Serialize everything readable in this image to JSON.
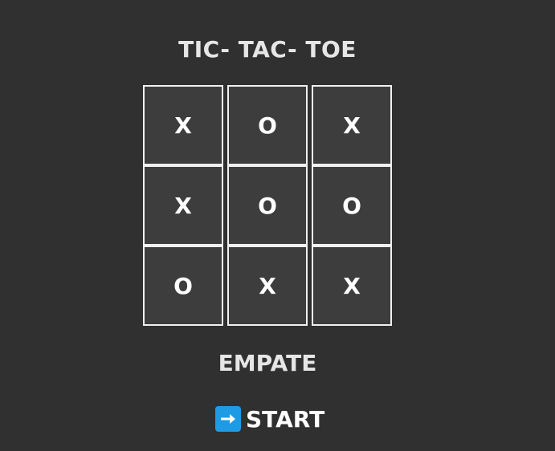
{
  "title": "TIC- TAC- TOE",
  "board": {
    "cells": [
      "X",
      "O",
      "X",
      "X",
      "O",
      "O",
      "O",
      "X",
      "X"
    ]
  },
  "status": "EMPATE",
  "start_button": {
    "label": "START",
    "icon": "right-arrow-icon",
    "icon_color": "#1d9be5"
  }
}
